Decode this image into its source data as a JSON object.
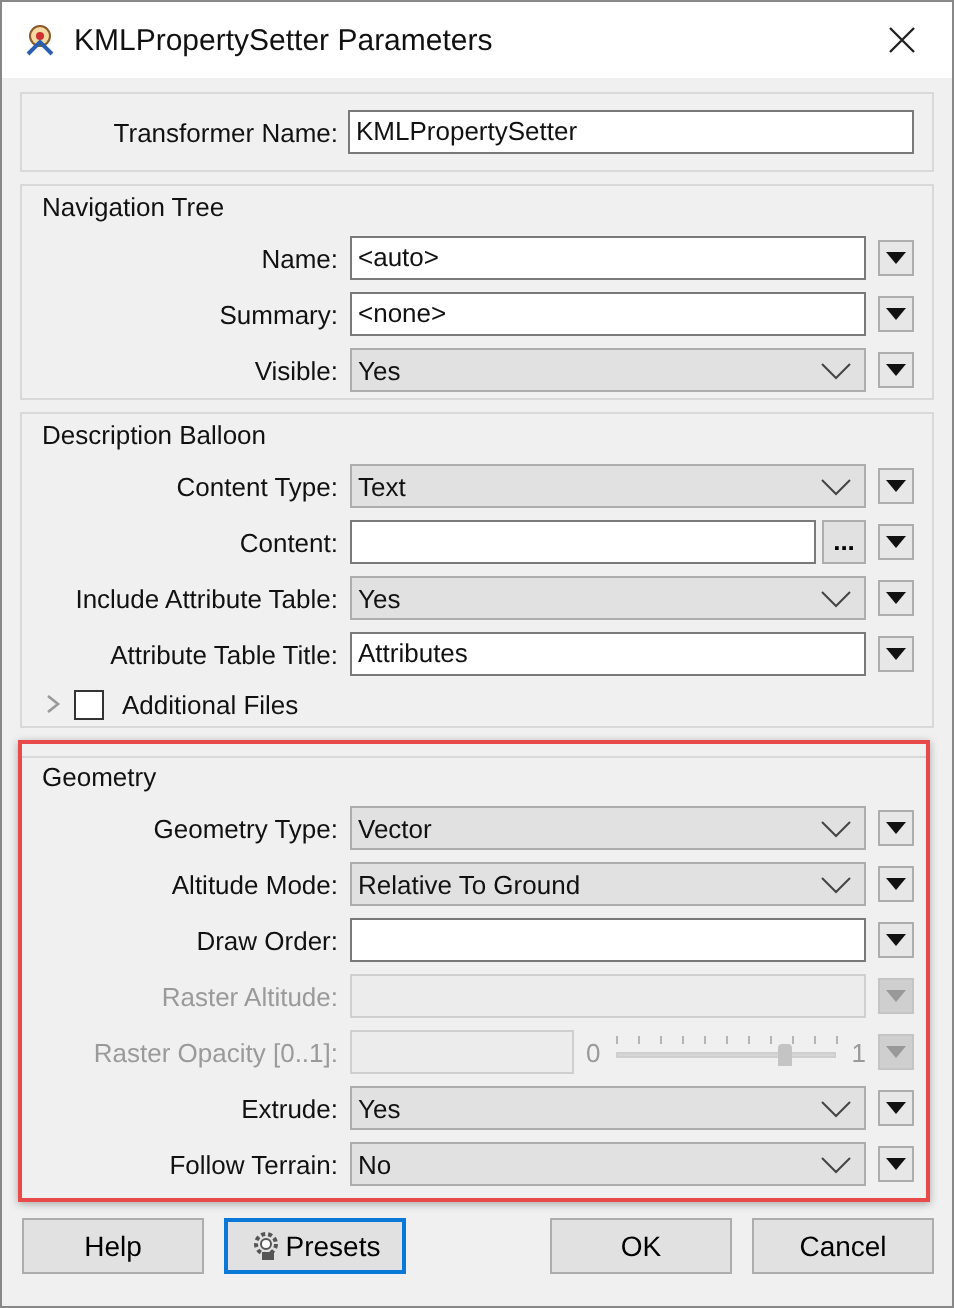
{
  "window": {
    "title": "KMLPropertySetter Parameters"
  },
  "transformer_name": {
    "label": "Transformer Name:",
    "value": "KMLPropertySetter"
  },
  "sections": [
    {
      "title": "Navigation Tree",
      "highlighted": false,
      "rows": [
        {
          "kind": "text",
          "label": "Name:",
          "value": "<auto>",
          "disabled": false
        },
        {
          "kind": "text",
          "label": "Summary:",
          "value": "<none>",
          "disabled": false
        },
        {
          "kind": "select",
          "label": "Visible:",
          "value": "Yes",
          "disabled": false
        }
      ]
    },
    {
      "title": "Description Balloon",
      "highlighted": false,
      "rows": [
        {
          "kind": "select",
          "label": "Content Type:",
          "value": "Text",
          "disabled": false
        },
        {
          "kind": "browse",
          "label": "Content:",
          "value": "",
          "button": "...",
          "disabled": false
        },
        {
          "kind": "select",
          "label": "Include Attribute Table:",
          "value": "Yes",
          "disabled": false
        },
        {
          "kind": "text",
          "label": "Attribute Table Title:",
          "value": "Attributes",
          "disabled": false
        },
        {
          "kind": "expander",
          "label": "Additional Files",
          "checked": false,
          "expanded": false
        }
      ]
    },
    {
      "title": "Geometry",
      "highlighted": true,
      "rows": [
        {
          "kind": "select",
          "label": "Geometry Type:",
          "value": "Vector",
          "disabled": false
        },
        {
          "kind": "select",
          "label": "Altitude Mode:",
          "value": "Relative To Ground",
          "disabled": false
        },
        {
          "kind": "text",
          "label": "Draw Order:",
          "value": "",
          "disabled": false
        },
        {
          "kind": "text",
          "label": "Raster Altitude:",
          "value": "",
          "disabled": true
        },
        {
          "kind": "slider",
          "label": "Raster Opacity [0..1]:",
          "min_label": "0",
          "max_label": "1",
          "level": 0.77,
          "disabled": true
        },
        {
          "kind": "select",
          "label": "Extrude:",
          "value": "Yes",
          "disabled": false
        },
        {
          "kind": "select",
          "label": "Follow Terrain:",
          "value": "No",
          "disabled": false
        }
      ]
    }
  ],
  "buttons": [
    {
      "label": "Help",
      "focused": false,
      "icon": false
    },
    {
      "label": "Presets",
      "focused": true,
      "icon": true
    },
    {
      "label": "OK",
      "focused": false,
      "icon": false
    },
    {
      "label": "Cancel",
      "focused": false,
      "icon": false
    }
  ]
}
